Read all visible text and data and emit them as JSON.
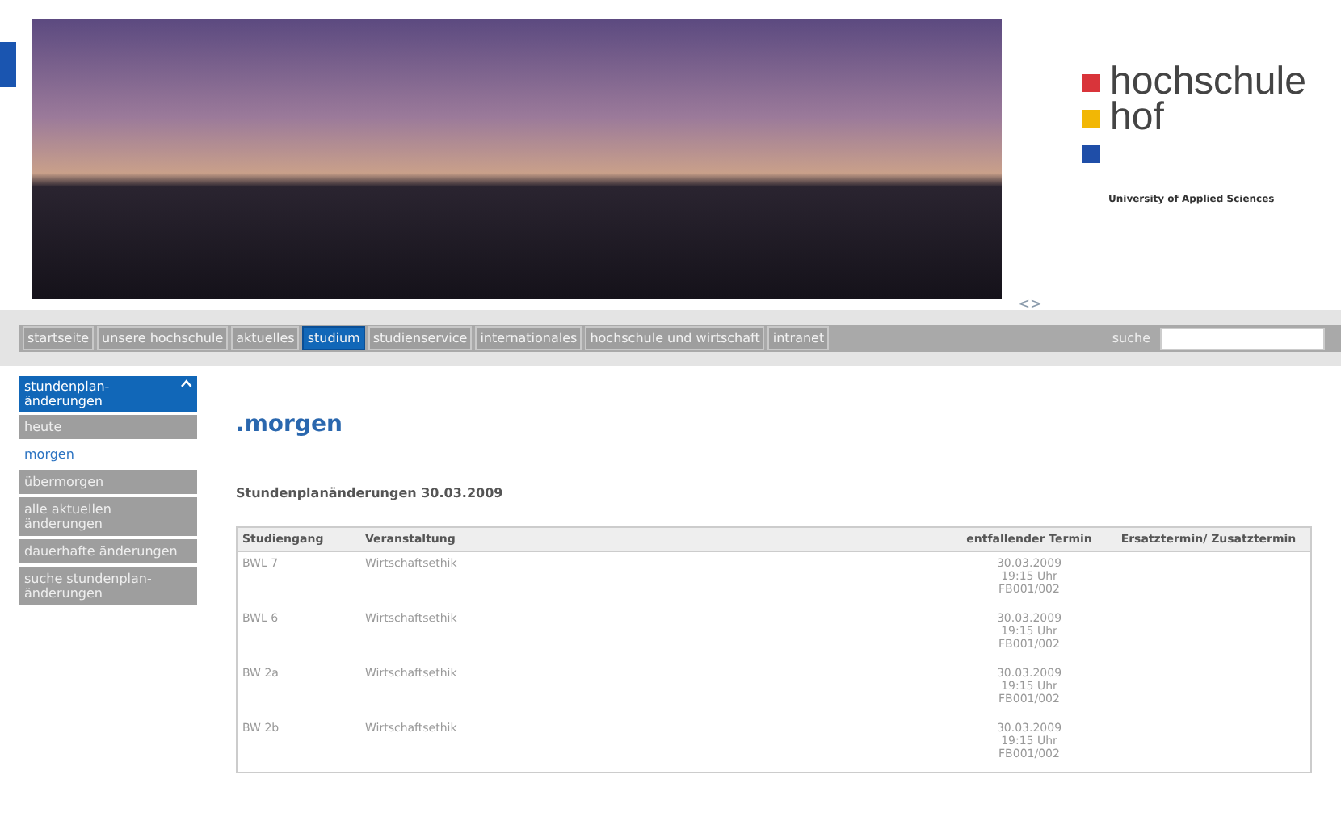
{
  "banner": {
    "pager": "<>"
  },
  "logo": {
    "line_1": "hochschule",
    "line_2": "hof",
    "tagline": "University of Applied Sciences",
    "squares": [
      {
        "color": "#d9343a"
      },
      {
        "color": "#f2b705"
      },
      {
        "color": "#1f4ea8"
      }
    ]
  },
  "nav": {
    "items": [
      {
        "label": "startseite",
        "selected": false
      },
      {
        "label": "unsere hochschule",
        "selected": false
      },
      {
        "label": "aktuelles",
        "selected": false
      },
      {
        "label": "studium",
        "selected": true
      },
      {
        "label": "studienservice",
        "selected": false
      },
      {
        "label": "internationales",
        "selected": false
      },
      {
        "label": "hochschule und wirtschaft",
        "selected": false
      },
      {
        "label": "intranet",
        "selected": false
      }
    ],
    "search_label": "suche"
  },
  "sidebar": {
    "header": "stundenplan-änderungen",
    "header_expanded": true,
    "items": [
      {
        "label": "heute",
        "selected": false
      },
      {
        "label": "morgen",
        "selected": true
      },
      {
        "label": "übermorgen",
        "selected": false
      },
      {
        "label": "alle aktuellen änderungen",
        "selected": false
      },
      {
        "label": "dauerhafte änderungen",
        "selected": false
      },
      {
        "label": "suche stundenplan-änderungen",
        "selected": false
      }
    ]
  },
  "content": {
    "title": ".morgen",
    "subtitle": "Stundenplanänderungen 30.03.2009",
    "table": {
      "columns": [
        "Studiengang",
        "Veranstaltung",
        "entfallender Termin",
        "Ersatztermin/ Zusatztermin"
      ],
      "rows": [
        {
          "studiengang": "BWL 7",
          "veranstaltung": "Wirtschaftsethik",
          "termin": [
            "30.03.2009",
            "19:15 Uhr",
            "FB001/002"
          ]
        },
        {
          "studiengang": "BWL 6",
          "veranstaltung": "Wirtschaftsethik",
          "termin": [
            "30.03.2009",
            "19:15 Uhr",
            "FB001/002"
          ]
        },
        {
          "studiengang": "BW 2a",
          "veranstaltung": "Wirtschaftsethik",
          "termin": [
            "30.03.2009",
            "19:15 Uhr",
            "FB001/002"
          ]
        },
        {
          "studiengang": "BW 2b",
          "veranstaltung": "Wirtschaftsethik",
          "termin": [
            "30.03.2009",
            "19:15 Uhr",
            "FB001/002"
          ]
        }
      ]
    }
  }
}
